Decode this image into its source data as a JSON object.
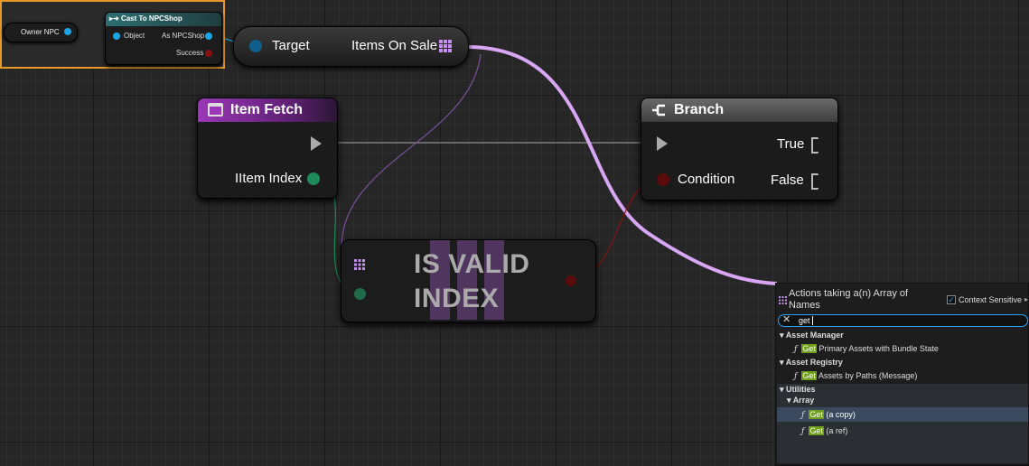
{
  "graph": {
    "owner_npc_label": "Owner NPC",
    "cast_node": {
      "title": "Cast To NPCShop",
      "object_pin": "Object",
      "as_pin": "As NPCShop",
      "success_pin": "Success"
    },
    "getter_node": {
      "target_pin": "Target",
      "output_pin": "Items On Sale"
    },
    "item_fetch": {
      "title": "Item Fetch",
      "index_pin": "IItem Index"
    },
    "branch": {
      "title": "Branch",
      "condition_pin": "Condition",
      "true_pin": "True",
      "false_pin": "False"
    },
    "is_valid": {
      "line1": "IS VALID",
      "line2": "INDEX"
    }
  },
  "action_menu": {
    "title": "Actions taking a(n) Array of Names",
    "context_sensitive_label": "Context Sensitive",
    "context_sensitive_checked": true,
    "search_value": "get",
    "categories": [
      {
        "name": "Asset Manager",
        "items": [
          {
            "match": "Get",
            "rest": " Primary Assets with Bundle State"
          }
        ]
      },
      {
        "name": "Asset Registry",
        "items": [
          {
            "match": "Get",
            "rest": " Assets by Paths (Message)"
          }
        ]
      },
      {
        "name": "Utilities",
        "subcategory": "Array",
        "items": [
          {
            "match": "Get",
            "rest": " (a copy)",
            "selected": true
          },
          {
            "match": "Get",
            "rest": " (a ref)"
          }
        ]
      }
    ]
  },
  "colors": {
    "selection": "#e79a2a",
    "wire_array": "#d9a6f5",
    "object_pin": "#1aa6e8",
    "int_pin": "#1f8a5a",
    "bool_pin": "#8a1010",
    "search_highlight": "#6f9e1b"
  }
}
